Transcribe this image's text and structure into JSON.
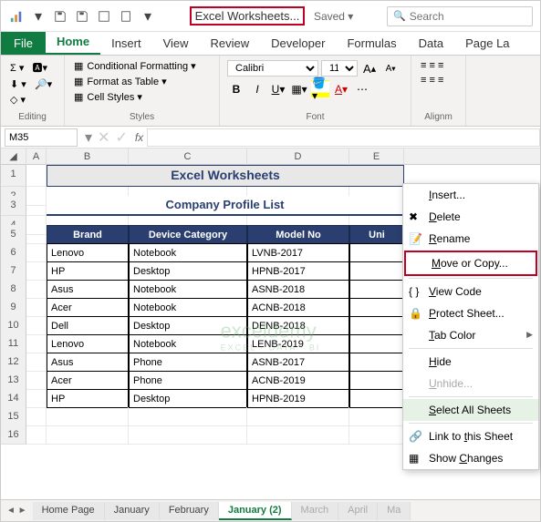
{
  "titlebar": {
    "filename": "Excel Worksheets...",
    "saved": "Saved ▾",
    "search_placeholder": "Search"
  },
  "tabs": {
    "file": "File",
    "items": [
      "Home",
      "Insert",
      "View",
      "Review",
      "Developer",
      "Formulas",
      "Data",
      "Page La"
    ],
    "active": 0
  },
  "ribbon": {
    "editing": {
      "label": "Editing"
    },
    "styles": {
      "label": "Styles",
      "cond": "Conditional Formatting ▾",
      "table": "Format as Table ▾",
      "cell": "Cell Styles ▾"
    },
    "font": {
      "label": "Font",
      "name": "Calibri",
      "size": "11",
      "inc": "A",
      "dec": "A"
    },
    "align": {
      "label": "Alignm"
    }
  },
  "namebox": "M35",
  "sheet": {
    "cols": [
      "",
      "A",
      "B",
      "C",
      "D",
      "E"
    ],
    "title": "Excel Worksheets",
    "subtitle": "Company Profile List",
    "headers": [
      "Brand",
      "Device Category",
      "Model No",
      "Uni"
    ],
    "rows": [
      {
        "n": 1
      },
      {
        "n": 2
      },
      {
        "n": 3
      },
      {
        "n": 4
      },
      {
        "n": 5
      },
      {
        "n": 6,
        "d": [
          "Lenovo",
          "Notebook",
          "LVNB-2017",
          ""
        ]
      },
      {
        "n": 7,
        "d": [
          "HP",
          "Desktop",
          "HPNB-2017",
          ""
        ]
      },
      {
        "n": 8,
        "d": [
          "Asus",
          "Notebook",
          "ASNB-2018",
          ""
        ]
      },
      {
        "n": 9,
        "d": [
          "Acer",
          "Notebook",
          "ACNB-2018",
          ""
        ]
      },
      {
        "n": 10,
        "d": [
          "Dell",
          "Desktop",
          "DENB-2018",
          ""
        ]
      },
      {
        "n": 11,
        "d": [
          "Lenovo",
          "Notebook",
          "LENB-2019",
          ""
        ]
      },
      {
        "n": 12,
        "d": [
          "Asus",
          "Phone",
          "ASNB-2017",
          ""
        ]
      },
      {
        "n": 13,
        "d": [
          "Acer",
          "Phone",
          "ACNB-2019",
          ""
        ]
      },
      {
        "n": 14,
        "d": [
          "HP",
          "Desktop",
          "HPNB-2019",
          ""
        ]
      },
      {
        "n": 15
      },
      {
        "n": 16
      }
    ]
  },
  "context_menu": {
    "items": [
      {
        "label": "Insert...",
        "icon": ""
      },
      {
        "label": "Delete",
        "icon": "del"
      },
      {
        "label": "Rename",
        "icon": "ren"
      },
      {
        "label": "Move or Copy...",
        "icon": "",
        "hl": true
      },
      {
        "label": "View Code",
        "icon": "code",
        "sep_before": true
      },
      {
        "label": "Protect Sheet...",
        "icon": "lock"
      },
      {
        "label": "Tab Color",
        "icon": "",
        "arrow": true
      },
      {
        "label": "Hide",
        "icon": "",
        "sep_before": true
      },
      {
        "label": "Unhide...",
        "icon": "",
        "disabled": true
      },
      {
        "label": "Select All Sheets",
        "icon": "",
        "sel": true,
        "sep_before": true
      },
      {
        "label": "Link to this Sheet",
        "icon": "link",
        "sep_before": true
      },
      {
        "label": "Show Changes",
        "icon": "show"
      }
    ]
  },
  "sheet_tabs": {
    "items": [
      "Home Page",
      "January",
      "February",
      "January (2)",
      "March",
      "April",
      "Ma"
    ],
    "active": 3
  },
  "watermark": {
    "main": "exceldemy",
    "sub": "EXCEL · DATA · BI"
  }
}
